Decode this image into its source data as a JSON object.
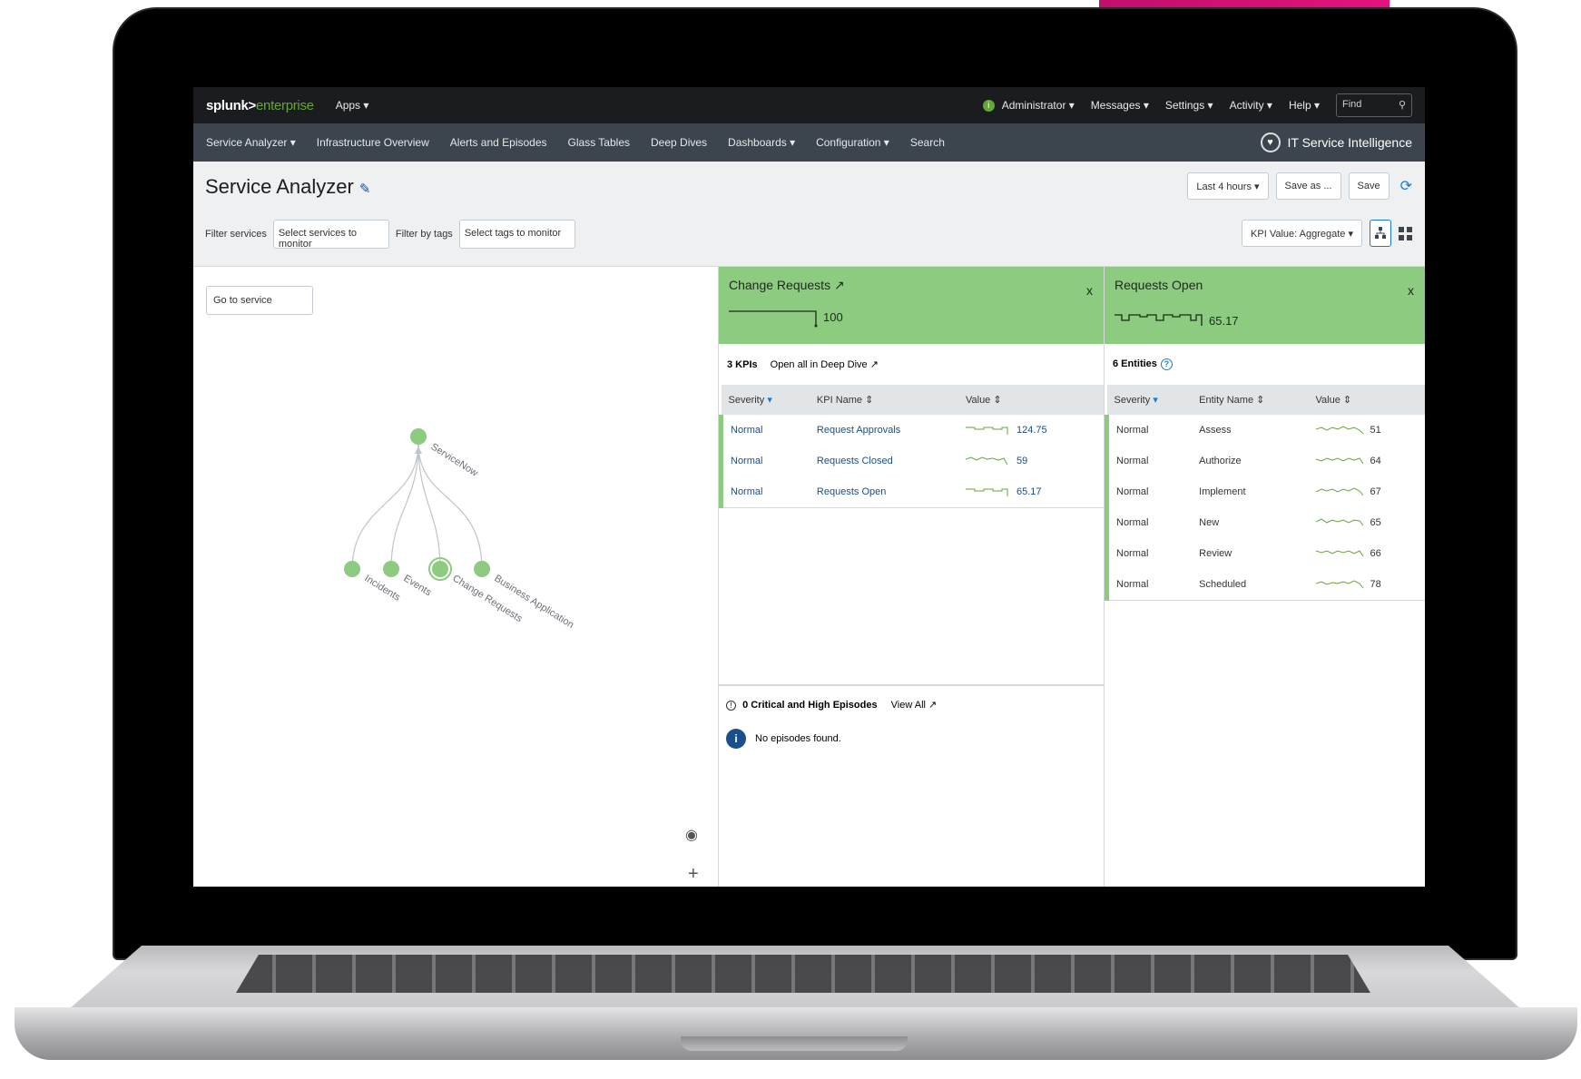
{
  "topbar": {
    "brand_splunk": "splunk>",
    "brand_enterprise": "enterprise",
    "apps": "Apps ▾",
    "user": "Administrator ▾",
    "messages": "Messages ▾",
    "settings": "Settings ▾",
    "activity": "Activity ▾",
    "help": "Help ▾",
    "find_placeholder": "Find"
  },
  "nav": {
    "items": [
      "Service Analyzer ▾",
      "Infrastructure Overview",
      "Alerts and Episodes",
      "Glass Tables",
      "Deep Dives",
      "Dashboards ▾",
      "Configuration ▾",
      "Search"
    ],
    "app_name": "IT Service Intelligence"
  },
  "header": {
    "title": "Service Analyzer",
    "time_range": "Last 4 hours ▾",
    "save_as": "Save as ...",
    "save": "Save",
    "filter_services_label": "Filter services",
    "filter_services_placeholder": "Select services to monitor",
    "filter_tags_label": "Filter by tags",
    "filter_tags_placeholder": "Select tags to monitor",
    "kpi_value": "KPI Value: Aggregate ▾"
  },
  "tree": {
    "goto": "Go to service",
    "nodes": {
      "root": "ServiceNow",
      "c1": "Incidents",
      "c2": "Events",
      "c3": "Change Requests",
      "c4": "Business Application"
    }
  },
  "change_panel": {
    "title": "Change Requests",
    "value": "100",
    "kpi_count": "3 KPIs",
    "open_all": "Open all in Deep Dive",
    "columns": [
      "Severity",
      "KPI Name",
      "Value"
    ],
    "rows": [
      {
        "severity": "Normal",
        "name": "Request Approvals",
        "value": "124.75"
      },
      {
        "severity": "Normal",
        "name": "Requests Closed",
        "value": "59"
      },
      {
        "severity": "Normal",
        "name": "Requests Open",
        "value": "65.17"
      }
    ],
    "episodes_title": "0 Critical and High Episodes",
    "view_all": "View All",
    "no_episodes": "No episodes found."
  },
  "requests_panel": {
    "title": "Requests Open",
    "value": "65.17",
    "entity_count": "6 Entities",
    "columns": [
      "Severity",
      "Entity Name",
      "Value"
    ],
    "rows": [
      {
        "severity": "Normal",
        "name": "Assess",
        "value": "51"
      },
      {
        "severity": "Normal",
        "name": "Authorize",
        "value": "64"
      },
      {
        "severity": "Normal",
        "name": "Implement",
        "value": "67"
      },
      {
        "severity": "Normal",
        "name": "New",
        "value": "65"
      },
      {
        "severity": "Normal",
        "name": "Review",
        "value": "66"
      },
      {
        "severity": "Normal",
        "name": "Scheduled",
        "value": "78"
      }
    ]
  },
  "colors": {
    "normal_green": "#8ccb80",
    "accent_pink": "#e5127e",
    "link_blue": "#1a4f8b"
  }
}
